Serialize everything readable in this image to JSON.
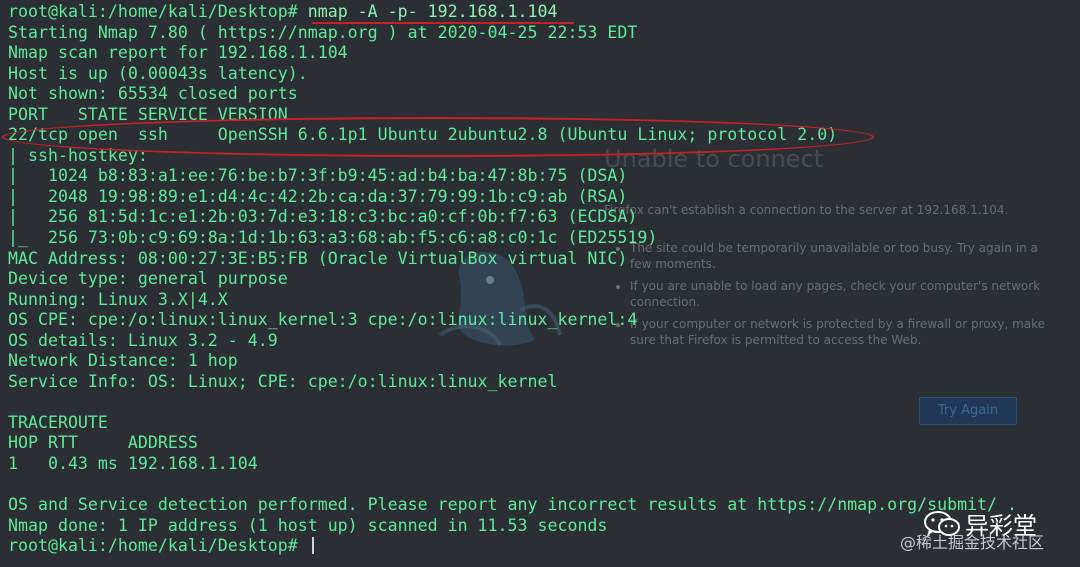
{
  "terminal": {
    "lines": [
      {
        "prompt": "root@kali:/home/kali/Desktop# ",
        "command": "nmap -A -p- 192.168.1.104"
      },
      {
        "text": "Starting Nmap 7.80 ( https://nmap.org ) at 2020-04-25 22:53 EDT"
      },
      {
        "text": "Nmap scan report for 192.168.1.104"
      },
      {
        "text": "Host is up (0.00043s latency)."
      },
      {
        "text": "Not shown: 65534 closed ports"
      },
      {
        "text": "PORT   STATE SERVICE VERSION"
      },
      {
        "text": "22/tcp open  ssh     OpenSSH 6.6.1p1 Ubuntu 2ubuntu2.8 (Ubuntu Linux; protocol 2.0)"
      },
      {
        "text": "| ssh-hostkey:"
      },
      {
        "text": "|   1024 b8:83:a1:ee:76:be:b7:3f:b9:45:ad:b4:ba:47:8b:75 (DSA)"
      },
      {
        "text": "|   2048 19:98:89:e1:d4:4c:42:2b:ca:da:37:79:99:1b:c9:ab (RSA)"
      },
      {
        "text": "|   256 81:5d:1c:e1:2b:03:7d:e3:18:c3:bc:a0:cf:0b:f7:63 (ECDSA)"
      },
      {
        "text": "|_  256 73:0b:c9:69:8a:1d:1b:63:a3:68:ab:f5:c6:a8:c0:1c (ED25519)"
      },
      {
        "text": "MAC Address: 08:00:27:3E:B5:FB (Oracle VirtualBox virtual NIC)"
      },
      {
        "text": "Device type: general purpose"
      },
      {
        "text": "Running: Linux 3.X|4.X"
      },
      {
        "text": "OS CPE: cpe:/o:linux:linux_kernel:3 cpe:/o:linux:linux_kernel:4"
      },
      {
        "text": "OS details: Linux 3.2 - 4.9"
      },
      {
        "text": "Network Distance: 1 hop"
      },
      {
        "text": "Service Info: OS: Linux; CPE: cpe:/o:linux:linux_kernel"
      },
      {
        "text": ""
      },
      {
        "text": "TRACEROUTE"
      },
      {
        "text": "HOP RTT     ADDRESS"
      },
      {
        "text": "1   0.43 ms 192.168.1.104"
      },
      {
        "text": ""
      },
      {
        "text": "OS and Service detection performed. Please report any incorrect results at https://nmap.org/submit/ ."
      },
      {
        "text": "Nmap done: 1 IP address (1 host up) scanned in 11.53 seconds"
      },
      {
        "prompt": "root@kali:/home/kali/Desktop# ",
        "command": ""
      }
    ],
    "text_color": "#5ee89a",
    "background_color": "#2b2f33",
    "annotation_color": "#c8202a"
  },
  "background_browser": {
    "title": "Unable to connect",
    "message": "Firefox can't establish a connection to the server at 192.168.1.104.",
    "bullets": [
      "The site could be temporarily unavailable or too busy. Try again in a few moments.",
      "If you are unable to load any pages, check your computer's network connection.",
      "If your computer or network is protected by a firewall or proxy, make sure that Firefox is permitted to access the Web."
    ],
    "button_label": "Try Again"
  },
  "watermark": {
    "brand": "异彩堂",
    "subtitle": "@稀土掘金技术社区",
    "logo_icon": "wechat-icon"
  }
}
